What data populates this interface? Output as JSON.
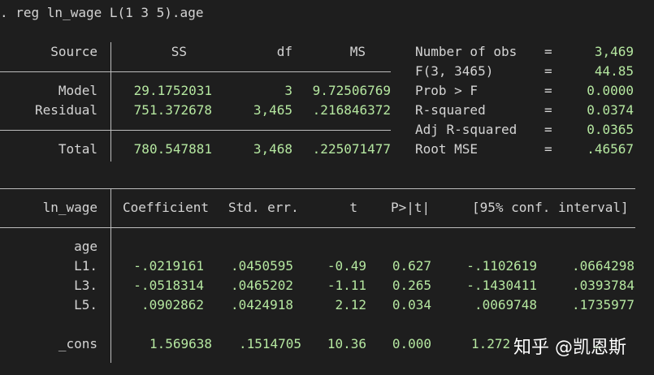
{
  "command": ". reg ln_wage L(1 3 5).age",
  "anova": {
    "headers": {
      "source": "Source",
      "ss": "SS",
      "df": "df",
      "ms": "MS"
    },
    "rows": [
      {
        "source": "Model",
        "ss": "29.1752031",
        "df": "3",
        "ms": "9.72506769"
      },
      {
        "source": "Residual",
        "ss": "751.372678",
        "df": "3,465",
        "ms": ".216846372"
      }
    ],
    "total": {
      "source": "Total",
      "ss": "780.547881",
      "df": "3,468",
      "ms": ".225071477"
    }
  },
  "stats": [
    {
      "label": "Number of obs",
      "eq": "=",
      "value": "3,469"
    },
    {
      "label": "F(3, 3465)",
      "eq": "=",
      "value": "44.85"
    },
    {
      "label": "Prob > F",
      "eq": "=",
      "value": "0.0000"
    },
    {
      "label": "R-squared",
      "eq": "=",
      "value": "0.0374"
    },
    {
      "label": "Adj R-squared",
      "eq": "=",
      "value": "0.0365"
    },
    {
      "label": "Root MSE",
      "eq": "=",
      "value": ".46567"
    }
  ],
  "coef_table": {
    "headers": {
      "var": "ln_wage",
      "coef": "Coefficient",
      "se": "Std. err.",
      "t": "t",
      "p": "P>|t|",
      "ci": "[95% conf. interval]"
    },
    "group_label": "age",
    "rows": [
      {
        "var": "L1.",
        "coef": "-.0219161",
        "se": ".0450595",
        "t": "-0.49",
        "p": "0.627",
        "lo": "-.1102619",
        "hi": ".0664298"
      },
      {
        "var": "L3.",
        "coef": "-.0518314",
        "se": ".0465202",
        "t": "-1.11",
        "p": "0.265",
        "lo": "-.1430411",
        "hi": ".0393784"
      },
      {
        "var": "L5.",
        "coef": ".0902862",
        "se": ".0424918",
        "t": "2.12",
        "p": "0.034",
        "lo": ".0069748",
        "hi": ".1735977"
      }
    ],
    "cons": {
      "var": "_cons",
      "coef": "1.569638",
      "se": ".1514705",
      "t": "10.36",
      "p": "0.000",
      "lo": "1.272",
      "hi": "…"
    }
  },
  "watermark": "知乎 @凯恩斯"
}
